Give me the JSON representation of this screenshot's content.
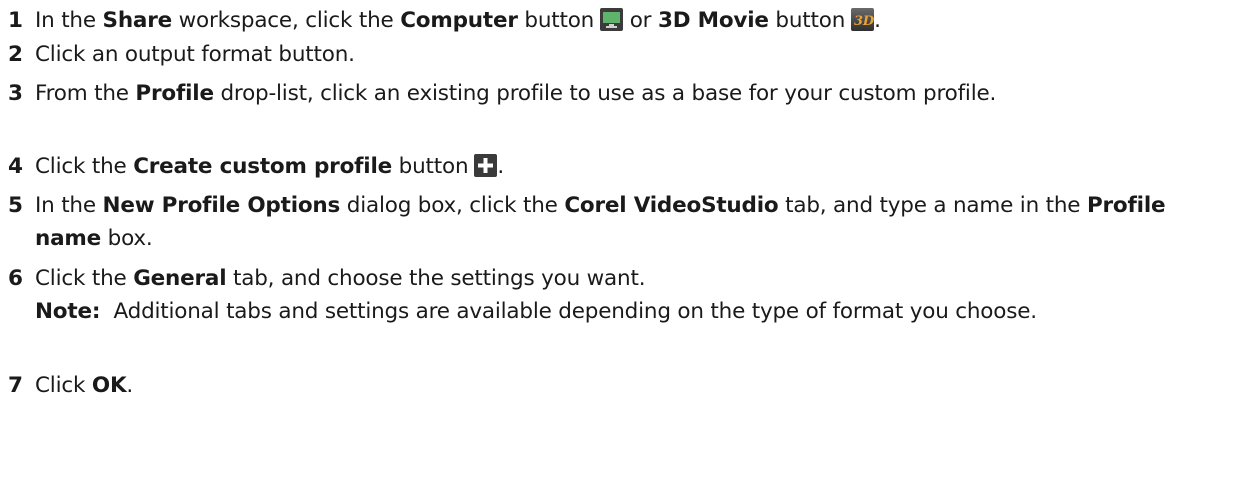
{
  "steps": [
    {
      "num": "1",
      "t0": "In the ",
      "b0": "Share",
      "t1": " workspace, click the ",
      "b1": "Computer",
      "t2": " button",
      "t3": " or ",
      "b2": "3D Movie",
      "t4": " button",
      "t5": ".",
      "icon_computer": "computer-monitor-icon",
      "icon_3d": "3d-movie-icon",
      "icon_3d_text": "3D"
    },
    {
      "num": "2",
      "t0": "Click an output format button."
    },
    {
      "num": "3",
      "t0": "From the ",
      "b0": "Profile",
      "t1": " drop-list, click an existing profile to use as a base for your custom profile."
    },
    {
      "num": "4",
      "t0": "Click the ",
      "b0": "Create custom profile",
      "t1": " button",
      "t2": ".",
      "icon_plus": "plus-icon"
    },
    {
      "num": "5",
      "t0": "In the ",
      "b0": "New Profile Options",
      "t1": " dialog box, click the ",
      "b1": "Corel VideoStudio",
      "t2": " tab, and type a name in the ",
      "b2": "Profile name",
      "t3": " box."
    },
    {
      "num": "6",
      "t0": "Click the ",
      "b0": "General",
      "t1": " tab, and choose the settings you want.",
      "note_label": "Note:",
      "note_text": "  Additional tabs and settings are available depending on the type of format you choose."
    },
    {
      "num": "7",
      "t0": "Click ",
      "b0": "OK",
      "t1": "."
    }
  ],
  "colors": {
    "text": "#1a1a1a",
    "icon_dark": "#3b3b3b",
    "icon_green": "#5fb36a",
    "icon_3d_bg": "#4a4a4a",
    "icon_3d_text": "#e8a43a"
  }
}
